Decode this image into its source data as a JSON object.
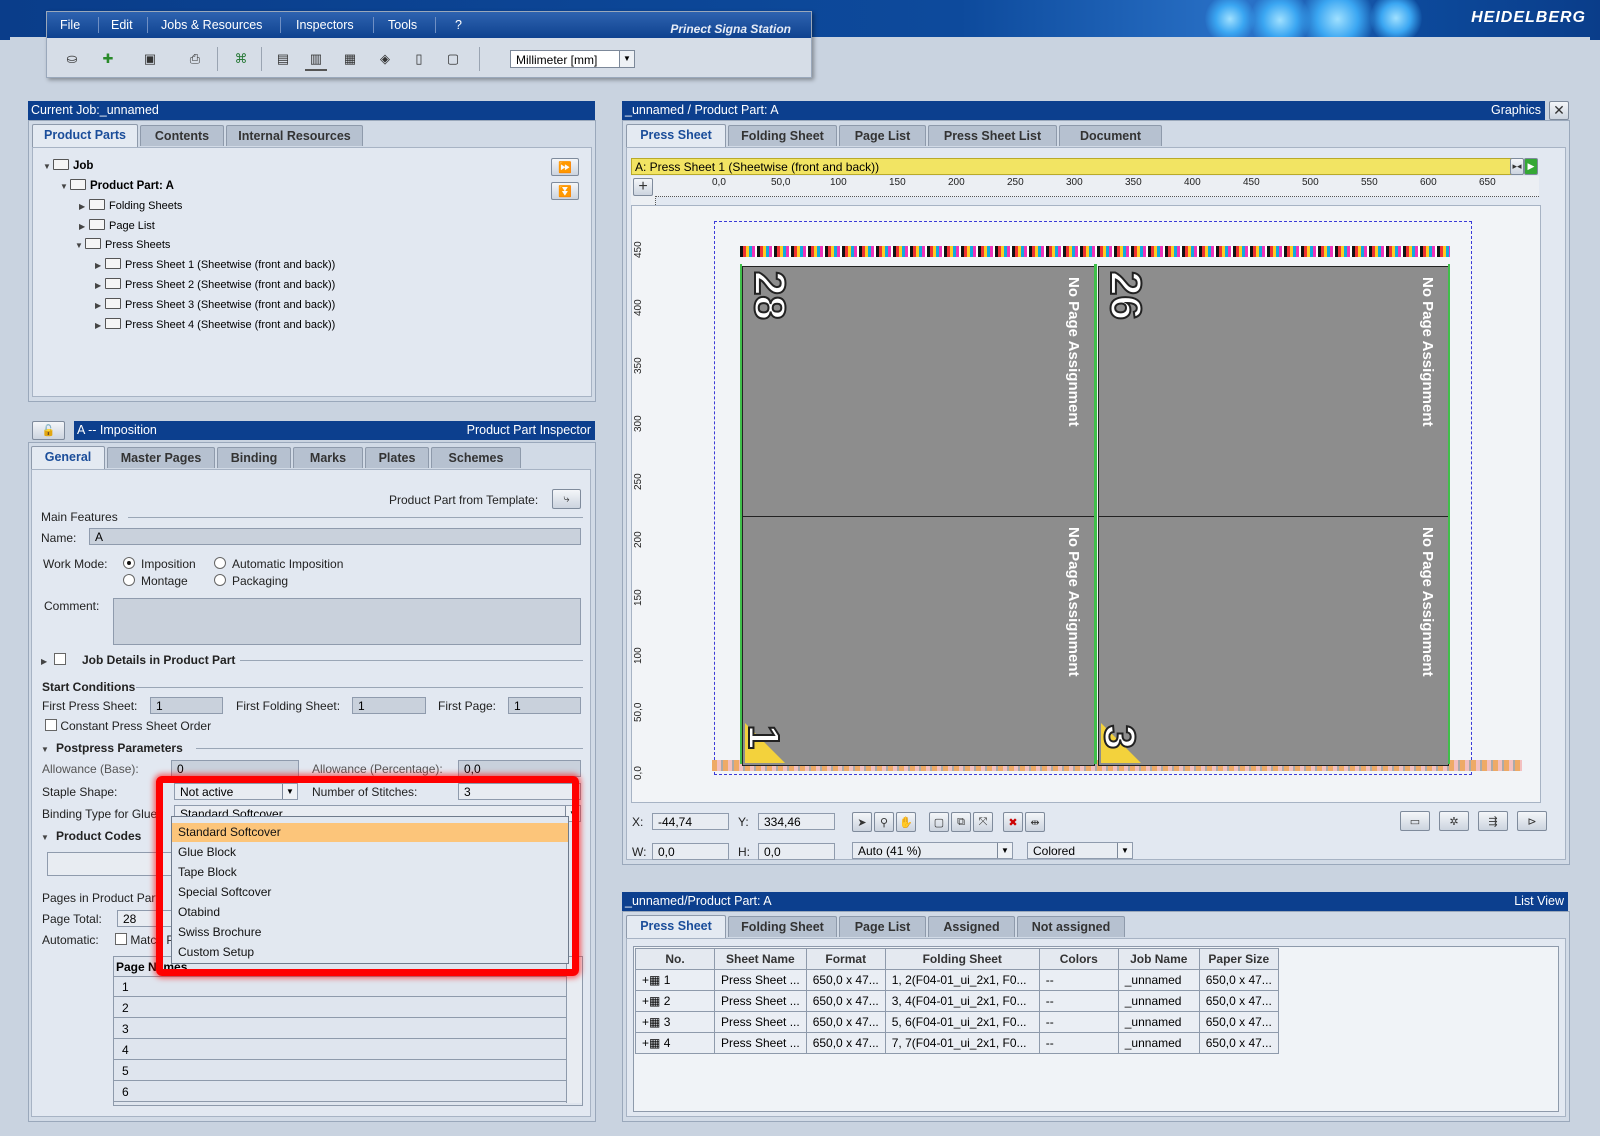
{
  "brand": "HEIDELBERG",
  "app": {
    "name": "Prinect Signa Station",
    "menus": [
      "File",
      "Edit",
      "Jobs & Resources",
      "Inspectors",
      "Tools",
      "?"
    ],
    "unit_select": "Millimeter  [mm]"
  },
  "job_panel": {
    "title": "Current Job:_unnamed",
    "tabs": [
      "Product Parts",
      "Contents",
      "Internal Resources"
    ],
    "tree": {
      "job": "Job",
      "product_part": "Product Part: A",
      "folding_sheets": "Folding Sheets",
      "page_list": "Page List",
      "press_sheets": "Press Sheets",
      "sheets": [
        "Press Sheet 1 (Sheetwise (front and back))",
        "Press Sheet 2 (Sheetwise (front and back))",
        "Press Sheet 3 (Sheetwise (front and back))",
        "Press Sheet 4 (Sheetwise (front and back))"
      ]
    }
  },
  "inspector": {
    "title": "A -- Imposition",
    "title_right": "Product Part Inspector",
    "tabs": [
      "General",
      "Master Pages",
      "Binding",
      "Marks",
      "Plates",
      "Schemes"
    ],
    "from_template": "Product Part from Template:",
    "main_features": "Main Features",
    "name_label": "Name:",
    "name_value": "A",
    "work_mode_label": "Work Mode:",
    "work_modes": [
      "Imposition",
      "Automatic Imposition",
      "Montage",
      "Packaging"
    ],
    "comment_label": "Comment:",
    "job_details": "Job Details in Product Part",
    "start_conditions": "Start Conditions",
    "first_press_sheet_label": "First Press Sheet:",
    "first_press_sheet": "1",
    "first_folding_sheet_label": "First Folding Sheet:",
    "first_folding_sheet": "1",
    "first_page_label": "First Page:",
    "first_page": "1",
    "constant_order": "Constant Press Sheet Order",
    "postpress": "Postpress Parameters",
    "allowance_base_label": "Allowance (Base):",
    "allowance_base": "0",
    "allowance_pct_label": "Allowance (Percentage):",
    "allowance_pct": "0,0",
    "staple_label": "Staple Shape:",
    "staple_value": "Not active",
    "stitches_label": "Number of Stitches:",
    "stitches_value": "3",
    "binding_type_label": "Binding Type for Glue",
    "binding_type_value": "Standard Softcover",
    "binding_options": [
      "Standard Softcover",
      "Glue Block",
      "Tape Block",
      "Special Softcover",
      "Otabind",
      "Swiss Brochure",
      "Custom Setup"
    ],
    "product_codes": "Product Codes",
    "pages_in_part": "Pages in Product Part",
    "page_total_label": "Page Total:",
    "page_total": "28",
    "automatic_label": "Automatic:",
    "match_label": "Match P",
    "page_names_header": "Page Names",
    "page_names": [
      "1",
      "2",
      "3",
      "4",
      "5",
      "6"
    ]
  },
  "graphics": {
    "title": "_unnamed / Product Part: A",
    "title_right": "Graphics",
    "tabs": [
      "Press Sheet",
      "Folding Sheet",
      "Page List",
      "Press Sheet List",
      "Document"
    ],
    "sheet_bar": "A:  Press Sheet 1 (Sheetwise (front and back))",
    "h_ticks": [
      "0,0",
      "50,0",
      "100",
      "150",
      "200",
      "250",
      "300",
      "350",
      "400",
      "450",
      "500",
      "550",
      "600",
      "650"
    ],
    "v_ticks": [
      "450",
      "400",
      "350",
      "300",
      "250",
      "200",
      "150",
      "100",
      "50,0",
      "0,0"
    ],
    "pages": [
      {
        "num": "28",
        "label": "No Page Assignment"
      },
      {
        "num": "26",
        "label": "No Page Assignment"
      },
      {
        "num": "1",
        "label": "No Page Assignment"
      },
      {
        "num": "3",
        "label": "No Page Assignment"
      }
    ],
    "x_label": "X:",
    "x": "-44,74",
    "y_label": "Y:",
    "y": "334,46",
    "w_label": "W:",
    "w": "0,0",
    "h_label": "H:",
    "h": "0,0",
    "zoom": "Auto (41 %)",
    "color_mode": "Colored"
  },
  "list_view": {
    "title": "_unnamed/Product Part: A",
    "title_right": "List View",
    "tabs": [
      "Press Sheet",
      "Folding Sheet",
      "Page List",
      "Assigned",
      "Not assigned"
    ],
    "columns": [
      "No.",
      "Sheet Name",
      "Format",
      "Folding Sheet",
      "Colors",
      "Job Name",
      "Paper Size"
    ],
    "rows": [
      [
        "1",
        "Press Sheet ...",
        "650,0 x 47...",
        "1, 2(F04-01_ui_2x1, F0...",
        "--",
        "_unnamed",
        "650,0 x 47..."
      ],
      [
        "2",
        "Press Sheet ...",
        "650,0 x 47...",
        "3, 4(F04-01_ui_2x1, F0...",
        "--",
        "_unnamed",
        "650,0 x 47..."
      ],
      [
        "3",
        "Press Sheet ...",
        "650,0 x 47...",
        "5, 6(F04-01_ui_2x1, F0...",
        "--",
        "_unnamed",
        "650,0 x 47..."
      ],
      [
        "4",
        "Press Sheet ...",
        "650,0 x 47...",
        "7, 7(F04-01_ui_2x1, F0...",
        "--",
        "_unnamed",
        "650,0 x 47..."
      ]
    ]
  }
}
